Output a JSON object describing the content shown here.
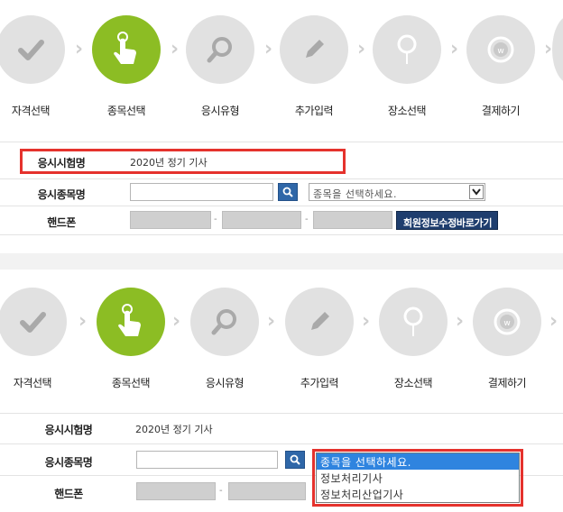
{
  "steps": [
    {
      "label": "자격선택",
      "icon": "check-icon",
      "active": false
    },
    {
      "label": "종목선택",
      "icon": "hand-pointer-icon",
      "active": true
    },
    {
      "label": "응시유형",
      "icon": "magnifier-icon",
      "active": false
    },
    {
      "label": "추가입력",
      "icon": "pencil-icon",
      "active": false
    },
    {
      "label": "장소선택",
      "icon": "map-pin-icon",
      "active": false
    },
    {
      "label": "결제하기",
      "icon": "won-coin-icon",
      "active": false
    }
  ],
  "form": {
    "exam_name_label": "응시시험명",
    "exam_name_value": "2020년 정기 기사",
    "subject_label": "응시종목명",
    "subject_placeholder": "종목을 선택하세요.",
    "phone_label": "핸드폰",
    "phone_separator": "-",
    "member_info_button": "회원정보수정바로가기"
  },
  "dropdown": {
    "options": [
      "종목을 선택하세요.",
      "정보처리기사",
      "정보처리산업기사"
    ],
    "selected_index": 0
  },
  "colors": {
    "active_step": "#8cbd24",
    "inactive_step": "#e1e1e1",
    "highlight": "#e5322d",
    "search_button": "#2f67a8",
    "member_button": "#1f3e6e",
    "selected_option": "#2f84df"
  }
}
